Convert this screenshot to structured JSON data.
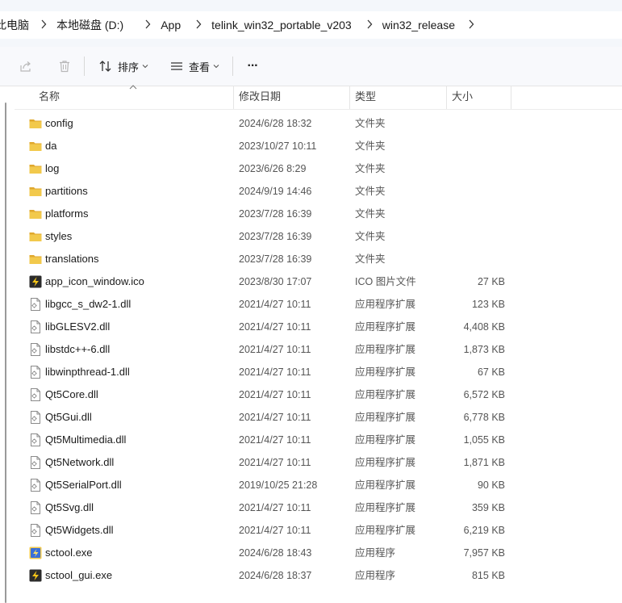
{
  "breadcrumb": [
    {
      "label": "此电脑",
      "name": "crumb-this-pc"
    },
    {
      "label": "本地磁盘 (D:)",
      "name": "crumb-drive-d"
    },
    {
      "label": "App",
      "name": "crumb-app"
    },
    {
      "label": "telink_win32_portable_v203",
      "name": "crumb-telink"
    },
    {
      "label": "win32_release",
      "name": "crumb-win32-release"
    }
  ],
  "toolbar": {
    "sort_label": "排序",
    "view_label": "查看",
    "more_label": "···"
  },
  "columns": {
    "name": "名称",
    "date": "修改日期",
    "type": "类型",
    "size": "大小"
  },
  "files": [
    {
      "name": "config",
      "date": "2024/6/28 18:32",
      "type": "文件夹",
      "size": "",
      "icon": "folder"
    },
    {
      "name": "da",
      "date": "2023/10/27 10:11",
      "type": "文件夹",
      "size": "",
      "icon": "folder"
    },
    {
      "name": "log",
      "date": "2023/6/26 8:29",
      "type": "文件夹",
      "size": "",
      "icon": "folder"
    },
    {
      "name": "partitions",
      "date": "2024/9/19 14:46",
      "type": "文件夹",
      "size": "",
      "icon": "folder"
    },
    {
      "name": "platforms",
      "date": "2023/7/28 16:39",
      "type": "文件夹",
      "size": "",
      "icon": "folder"
    },
    {
      "name": "styles",
      "date": "2023/7/28 16:39",
      "type": "文件夹",
      "size": "",
      "icon": "folder"
    },
    {
      "name": "translations",
      "date": "2023/7/28 16:39",
      "type": "文件夹",
      "size": "",
      "icon": "folder"
    },
    {
      "name": "app_icon_window.ico",
      "date": "2023/8/30 17:07",
      "type": "ICO 图片文件",
      "size": "27 KB",
      "icon": "app"
    },
    {
      "name": "libgcc_s_dw2-1.dll",
      "date": "2021/4/27 10:11",
      "type": "应用程序扩展",
      "size": "123 KB",
      "icon": "dll"
    },
    {
      "name": "libGLESV2.dll",
      "date": "2021/4/27 10:11",
      "type": "应用程序扩展",
      "size": "4,408 KB",
      "icon": "dll"
    },
    {
      "name": "libstdc++-6.dll",
      "date": "2021/4/27 10:11",
      "type": "应用程序扩展",
      "size": "1,873 KB",
      "icon": "dll"
    },
    {
      "name": "libwinpthread-1.dll",
      "date": "2021/4/27 10:11",
      "type": "应用程序扩展",
      "size": "67 KB",
      "icon": "dll"
    },
    {
      "name": "Qt5Core.dll",
      "date": "2021/4/27 10:11",
      "type": "应用程序扩展",
      "size": "6,572 KB",
      "icon": "dll"
    },
    {
      "name": "Qt5Gui.dll",
      "date": "2021/4/27 10:11",
      "type": "应用程序扩展",
      "size": "6,778 KB",
      "icon": "dll"
    },
    {
      "name": "Qt5Multimedia.dll",
      "date": "2021/4/27 10:11",
      "type": "应用程序扩展",
      "size": "1,055 KB",
      "icon": "dll"
    },
    {
      "name": "Qt5Network.dll",
      "date": "2021/4/27 10:11",
      "type": "应用程序扩展",
      "size": "1,871 KB",
      "icon": "dll"
    },
    {
      "name": "Qt5SerialPort.dll",
      "date": "2019/10/25 21:28",
      "type": "应用程序扩展",
      "size": "90 KB",
      "icon": "dll"
    },
    {
      "name": "Qt5Svg.dll",
      "date": "2021/4/27 10:11",
      "type": "应用程序扩展",
      "size": "359 KB",
      "icon": "dll"
    },
    {
      "name": "Qt5Widgets.dll",
      "date": "2021/4/27 10:11",
      "type": "应用程序扩展",
      "size": "6,219 KB",
      "icon": "dll"
    },
    {
      "name": "sctool.exe",
      "date": "2024/6/28 18:43",
      "type": "应用程序",
      "size": "7,957 KB",
      "icon": "exe-color"
    },
    {
      "name": "sctool_gui.exe",
      "date": "2024/6/28 18:37",
      "type": "应用程序",
      "size": "815 KB",
      "icon": "app"
    }
  ],
  "colors": {
    "folder": "#f2c94c",
    "folder_tab": "#e0a82e",
    "accent": "#1a1a1a"
  }
}
